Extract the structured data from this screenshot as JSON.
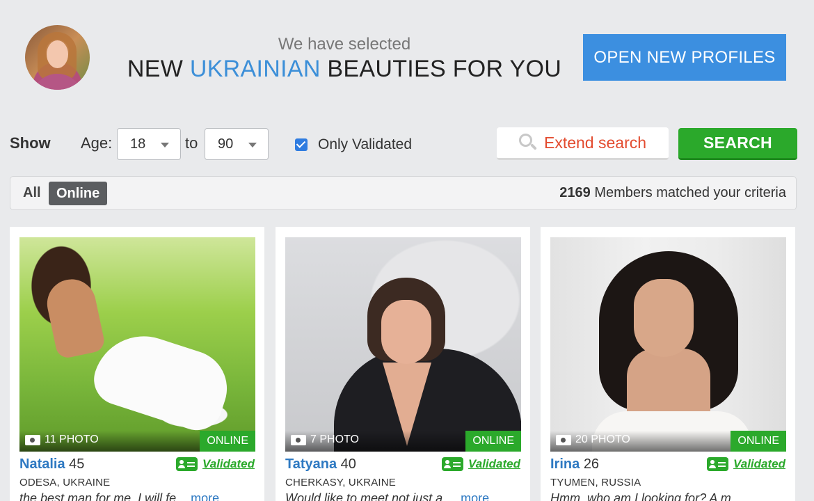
{
  "banner": {
    "subtitle": "We have selected",
    "title_pre": "NEW ",
    "title_accent": "UKRAINIAN",
    "title_post": " BEAUTIES FOR YOU",
    "open_button": "OPEN NEW PROFILES",
    "accent_color": "#3c8fd8"
  },
  "filters": {
    "show_label": "Show",
    "age_label": "Age:",
    "age_from": "18",
    "to_label": "to",
    "age_to": "90",
    "only_validated_label": "Only Validated",
    "only_validated_checked": true,
    "extend_search_label": "Extend search",
    "search_button_label": "SEARCH"
  },
  "results": {
    "tab_all": "All",
    "tab_online": "Online",
    "count": "2169",
    "count_suffix": "Members matched your criteria"
  },
  "profiles": [
    {
      "photo_count": "11 PHOTO",
      "status": "ONLINE",
      "name": "Natalia",
      "age": "45",
      "validated": "Validated",
      "location": "ODESA, UKRAINE",
      "bio": "the best man for me. I will fe...",
      "more": "more"
    },
    {
      "photo_count": "7 PHOTO",
      "status": "ONLINE",
      "name": "Tatyana",
      "age": "40",
      "validated": "Validated",
      "location": "CHERKASY, UKRAINE",
      "bio": "Would like to meet not just a ...",
      "more": "more"
    },
    {
      "photo_count": "20 PHOTO",
      "status": "ONLINE",
      "name": "Irina",
      "age": "26",
      "validated": "Validated",
      "location": "TYUMEN, RUSSIA",
      "bio": "Hmm, who am I looking for? A m...",
      "more": ""
    }
  ],
  "colors": {
    "green": "#2ba92b",
    "blue_button": "#3c8fe0",
    "link": "#2e79c2",
    "extend_search_text": "#e34b2f"
  }
}
